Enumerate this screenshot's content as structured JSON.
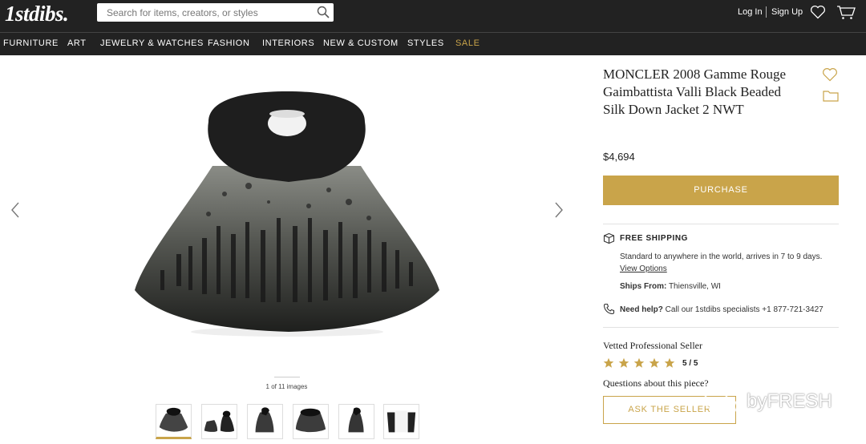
{
  "header": {
    "logo": "1stdibs.",
    "search_placeholder": "Search for items, creators, or styles",
    "login": "Log In",
    "signup": "Sign Up"
  },
  "nav": {
    "items": [
      "FURNITURE",
      "ART",
      "JEWELRY & WATCHES",
      "FASHION",
      "INTERIORS",
      "NEW & CUSTOM",
      "STYLES",
      "SALE"
    ],
    "sale_color": "#c9a44a"
  },
  "gallery": {
    "image_count": "1 of 11 images",
    "thumb_count": 6
  },
  "product": {
    "title": "MONCLER 2008 Gamme Rouge Gaimbattista Valli Black Beaded Silk Down Jacket 2 NWT",
    "price": "$4,694",
    "purchase_label": "PURCHASE"
  },
  "shipping": {
    "title": "FREE SHIPPING",
    "desc": "Standard to anywhere in the world, arrives in 7 to 9 days.",
    "link": "View Options",
    "ships_from_label": "Ships From:",
    "ships_from_value": " Thiensville, WI"
  },
  "help": {
    "label": "Need help?",
    "text": " Call our 1stdibs specialists +1 877-721-3427"
  },
  "seller": {
    "vetted": "Vetted Professional Seller",
    "stars": 5,
    "rating": "5 / 5",
    "questions": "Questions about this piece?",
    "ask_label": "ASK THE SELLER"
  },
  "watermark": {
    "text": "byFRESH"
  },
  "colors": {
    "header_bg": "#222222",
    "accent_gold": "#c9a44a"
  },
  "icons": [
    "search-icon",
    "heart-icon",
    "cart-icon",
    "chevron-left-icon",
    "chevron-right-icon",
    "favorite-heart-icon",
    "folder-icon",
    "box-icon",
    "phone-icon",
    "star-icon"
  ]
}
